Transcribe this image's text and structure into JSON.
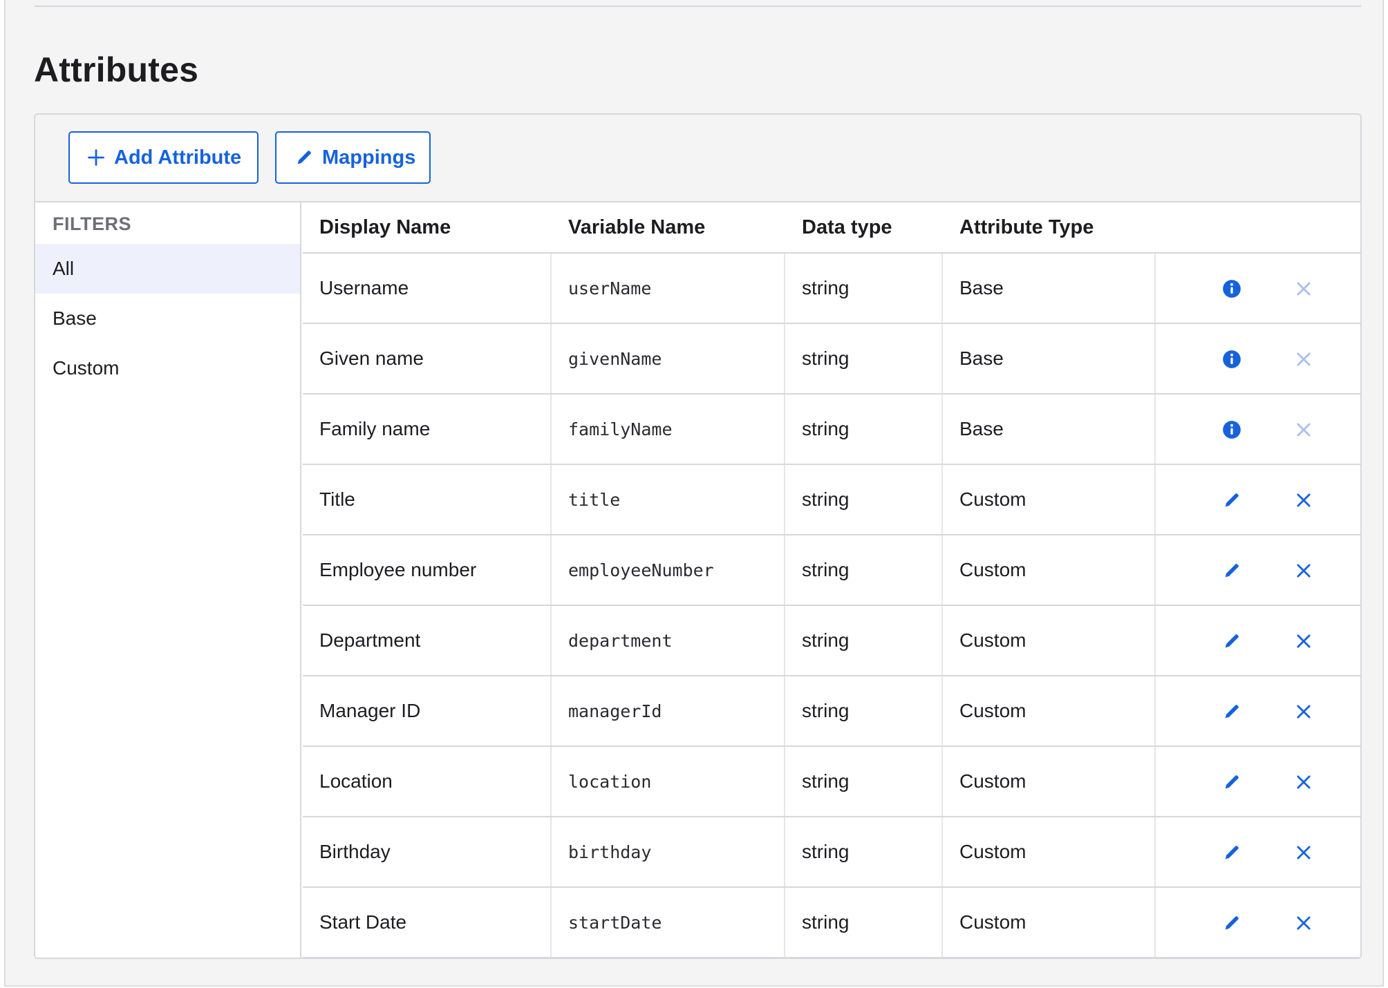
{
  "page": {
    "title": "Attributes"
  },
  "toolbar": {
    "add_label": "Add Attribute",
    "mappings_label": "Mappings"
  },
  "filters": {
    "heading": "FILTERS",
    "items": [
      {
        "label": "All",
        "active": true
      },
      {
        "label": "Base",
        "active": false
      },
      {
        "label": "Custom",
        "active": false
      }
    ]
  },
  "table": {
    "headers": [
      "Display Name",
      "Variable Name",
      "Data type",
      "Attribute Type"
    ],
    "rows": [
      {
        "display": "Username",
        "variable": "userName",
        "type": "string",
        "attr_type": "Base",
        "action_icon": "info-icon",
        "delete_enabled": false
      },
      {
        "display": "Given name",
        "variable": "givenName",
        "type": "string",
        "attr_type": "Base",
        "action_icon": "info-icon",
        "delete_enabled": false
      },
      {
        "display": "Family name",
        "variable": "familyName",
        "type": "string",
        "attr_type": "Base",
        "action_icon": "info-icon",
        "delete_enabled": false
      },
      {
        "display": "Title",
        "variable": "title",
        "type": "string",
        "attr_type": "Custom",
        "action_icon": "pencil-icon",
        "delete_enabled": true
      },
      {
        "display": "Employee number",
        "variable": "employeeNumber",
        "type": "string",
        "attr_type": "Custom",
        "action_icon": "pencil-icon",
        "delete_enabled": true
      },
      {
        "display": "Department",
        "variable": "department",
        "type": "string",
        "attr_type": "Custom",
        "action_icon": "pencil-icon",
        "delete_enabled": true
      },
      {
        "display": "Manager ID",
        "variable": "managerId",
        "type": "string",
        "attr_type": "Custom",
        "action_icon": "pencil-icon",
        "delete_enabled": true
      },
      {
        "display": "Location",
        "variable": "location",
        "type": "string",
        "attr_type": "Custom",
        "action_icon": "pencil-icon",
        "delete_enabled": true
      },
      {
        "display": "Birthday",
        "variable": "birthday",
        "type": "string",
        "attr_type": "Custom",
        "action_icon": "pencil-icon",
        "delete_enabled": true
      },
      {
        "display": "Start Date",
        "variable": "startDate",
        "type": "string",
        "attr_type": "Custom",
        "action_icon": "pencil-icon",
        "delete_enabled": true
      }
    ]
  },
  "colors": {
    "accent": "#1662dd",
    "delete_disabled": "#a9bfee",
    "active_filter_bg": "#eef1fb"
  }
}
